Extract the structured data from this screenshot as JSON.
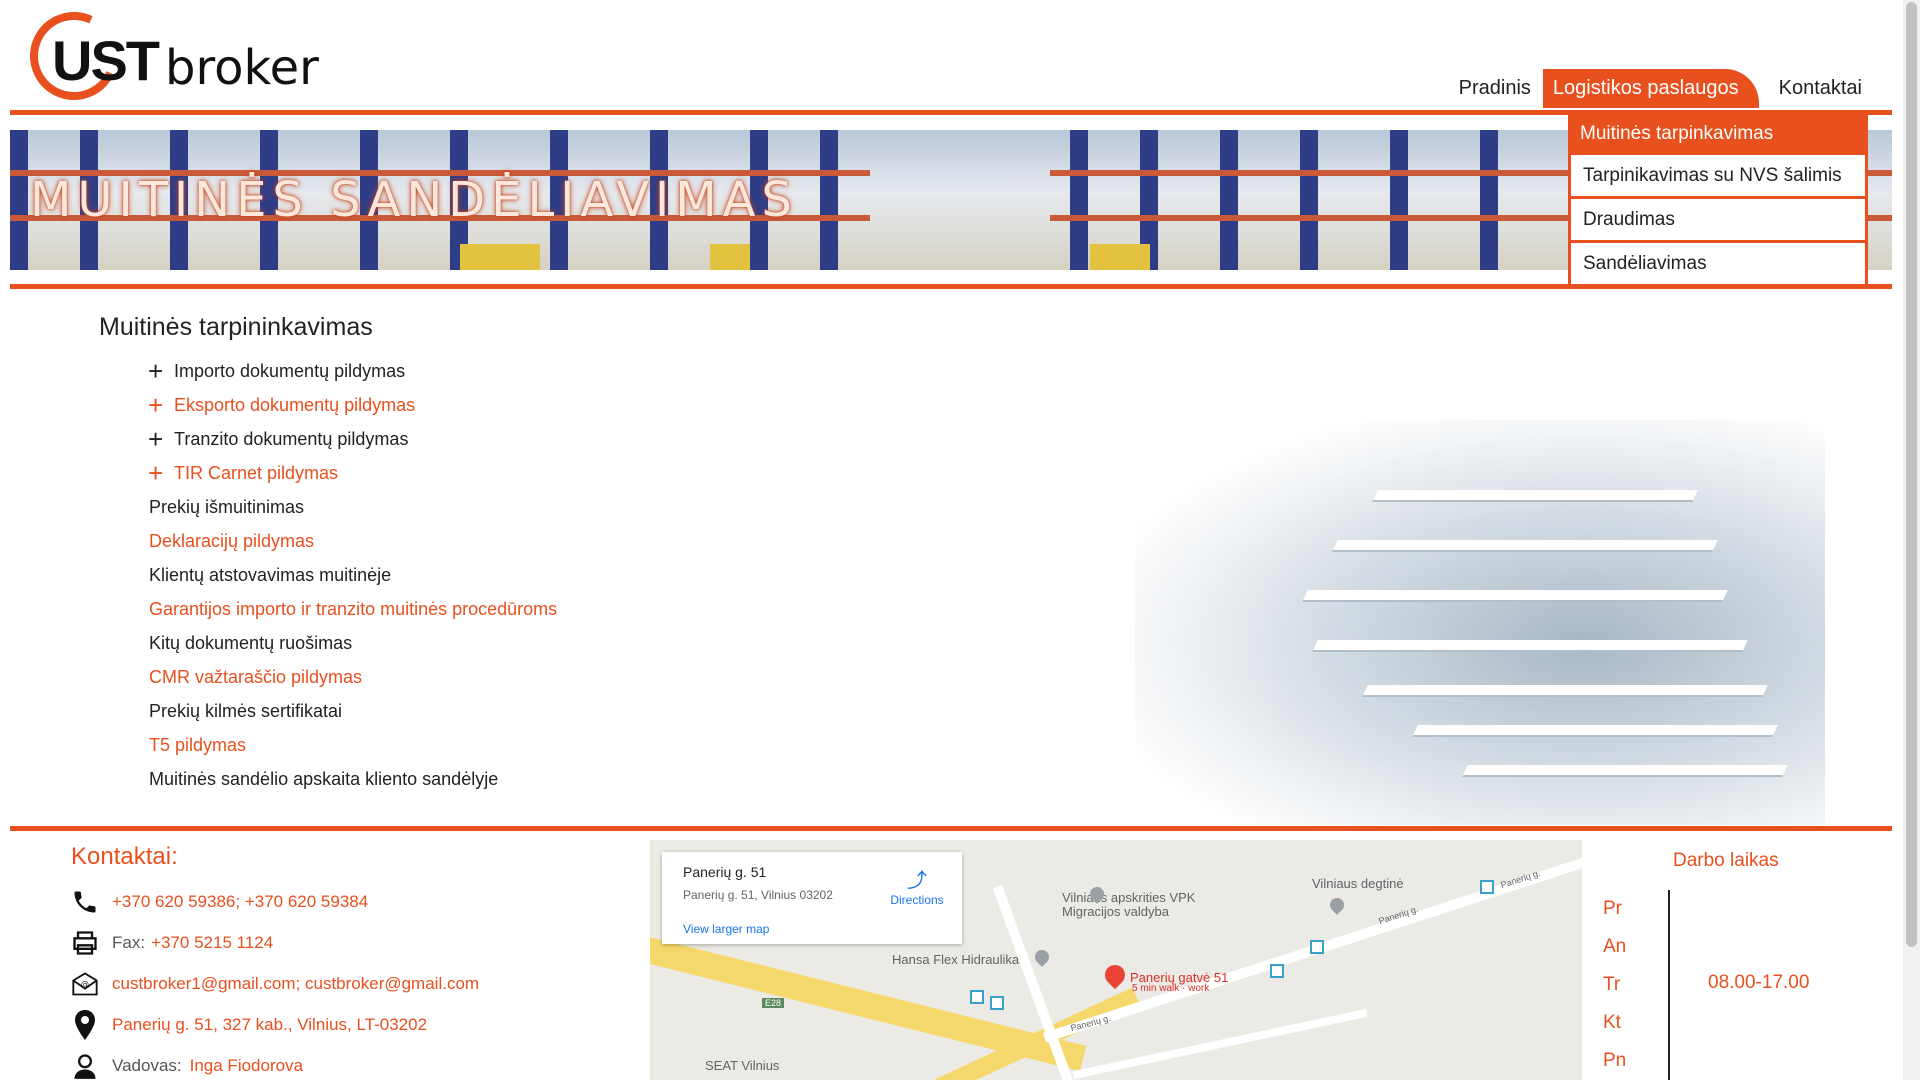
{
  "logo": {
    "part1": "UST",
    "part2": "broker"
  },
  "nav": {
    "items": [
      {
        "label": "Pradinis"
      },
      {
        "label": "Logistikos paslaugos"
      },
      {
        "label": "Kontaktai"
      }
    ],
    "dropdown": [
      "Muitinės tarpinkavimas",
      "Tarpinikavimas su NVS šalimis",
      "Draudimas",
      "Sandėliavimas"
    ]
  },
  "banner": {
    "title": "MUITINĖS SANDĖLIAVIMAS"
  },
  "main": {
    "title": "Muitinės tarpininkavimas",
    "services": [
      {
        "label": "Importo dokumentų pildymas",
        "plus": "+"
      },
      {
        "label": "Eksporto dokumentų pildymas",
        "plus": "+"
      },
      {
        "label": "Tranzito dokumentų pildymas",
        "plus": "+"
      },
      {
        "label": "TIR Carnet pildymas",
        "plus": "+"
      },
      {
        "label": "Prekių išmuitinimas"
      },
      {
        "label": "Deklaracijų pildymas"
      },
      {
        "label": "Klientų atstovavimas muitinėje"
      },
      {
        "label": "Garantijos importo ir tranzito muitinės procedūroms"
      },
      {
        "label": "Kitų dokumentų ruošimas"
      },
      {
        "label": "CMR važtaraščio pildymas"
      },
      {
        "label": "Prekių kilmės sertifikatai"
      },
      {
        "label": "T5 pildymas"
      },
      {
        "label": "Muitinės sandėlio apskaita kliento sandėlyje"
      }
    ]
  },
  "contacts": {
    "title": "Kontaktai:",
    "phones": "+370 620 59386; +370 620 59384",
    "fax_label": "Fax:",
    "fax": "+370 5215 1124",
    "emails": "custbroker1@gmail.com; custbroker@gmail.com",
    "address": "Panerių g. 51, 327 kab., Vilnius, LT-03202",
    "manager_label": "Vadovas:",
    "manager": "Inga Fiodorova"
  },
  "map": {
    "card_title": "Panerių g. 51",
    "card_address": "Panerių g. 51, Vilnius 03202",
    "directions": "Directions",
    "larger": "View larger map",
    "labels": {
      "vpk": "Vilniaus apskrities VPK",
      "migr": "Migracijos valdyba",
      "degtine": "Vilniaus degtinė",
      "hansa": "Hansa Flex Hidraulika",
      "paneriu": "Panerių gatvė 51",
      "walk": "5 min walk · work",
      "seat": "SEAT Vilnius",
      "e28": "E28",
      "street1": "Panerių g.",
      "street2": "Panerių g.",
      "street3": "Panerių g."
    }
  },
  "hours": {
    "title": "Darbo laikas",
    "days": [
      "Pr",
      "An",
      "Tr",
      "Kt",
      "Pn"
    ],
    "value": "08.00-17.00"
  },
  "colors": {
    "accent": "#e8501e"
  }
}
